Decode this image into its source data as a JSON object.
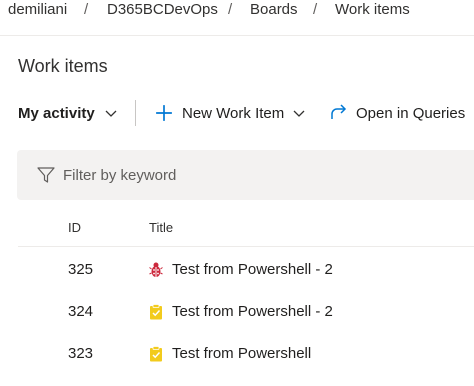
{
  "breadcrumb": {
    "items": [
      "demiliani",
      "D365BCDevOps",
      "Boards",
      "Work items"
    ],
    "separator": "/"
  },
  "page": {
    "title": "Work items"
  },
  "toolbar": {
    "view_selector": "My activity",
    "new_item": "New Work Item",
    "open_queries": "Open in Queries"
  },
  "filter": {
    "placeholder": "Filter by keyword",
    "value": ""
  },
  "grid": {
    "columns": [
      "ID",
      "Title"
    ],
    "rows": [
      {
        "id": "325",
        "title": "Test from Powershell - 2",
        "type_icon": "bug-icon"
      },
      {
        "id": "324",
        "title": "Test from Powershell - 2",
        "type_icon": "task-icon"
      },
      {
        "id": "323",
        "title": "Test from Powershell",
        "type_icon": "task-icon"
      }
    ]
  },
  "colors": {
    "accent": "#0078d4",
    "bug": "#cc293d",
    "task": "#f2cb1d",
    "filter_bg": "#f3f2f1"
  }
}
